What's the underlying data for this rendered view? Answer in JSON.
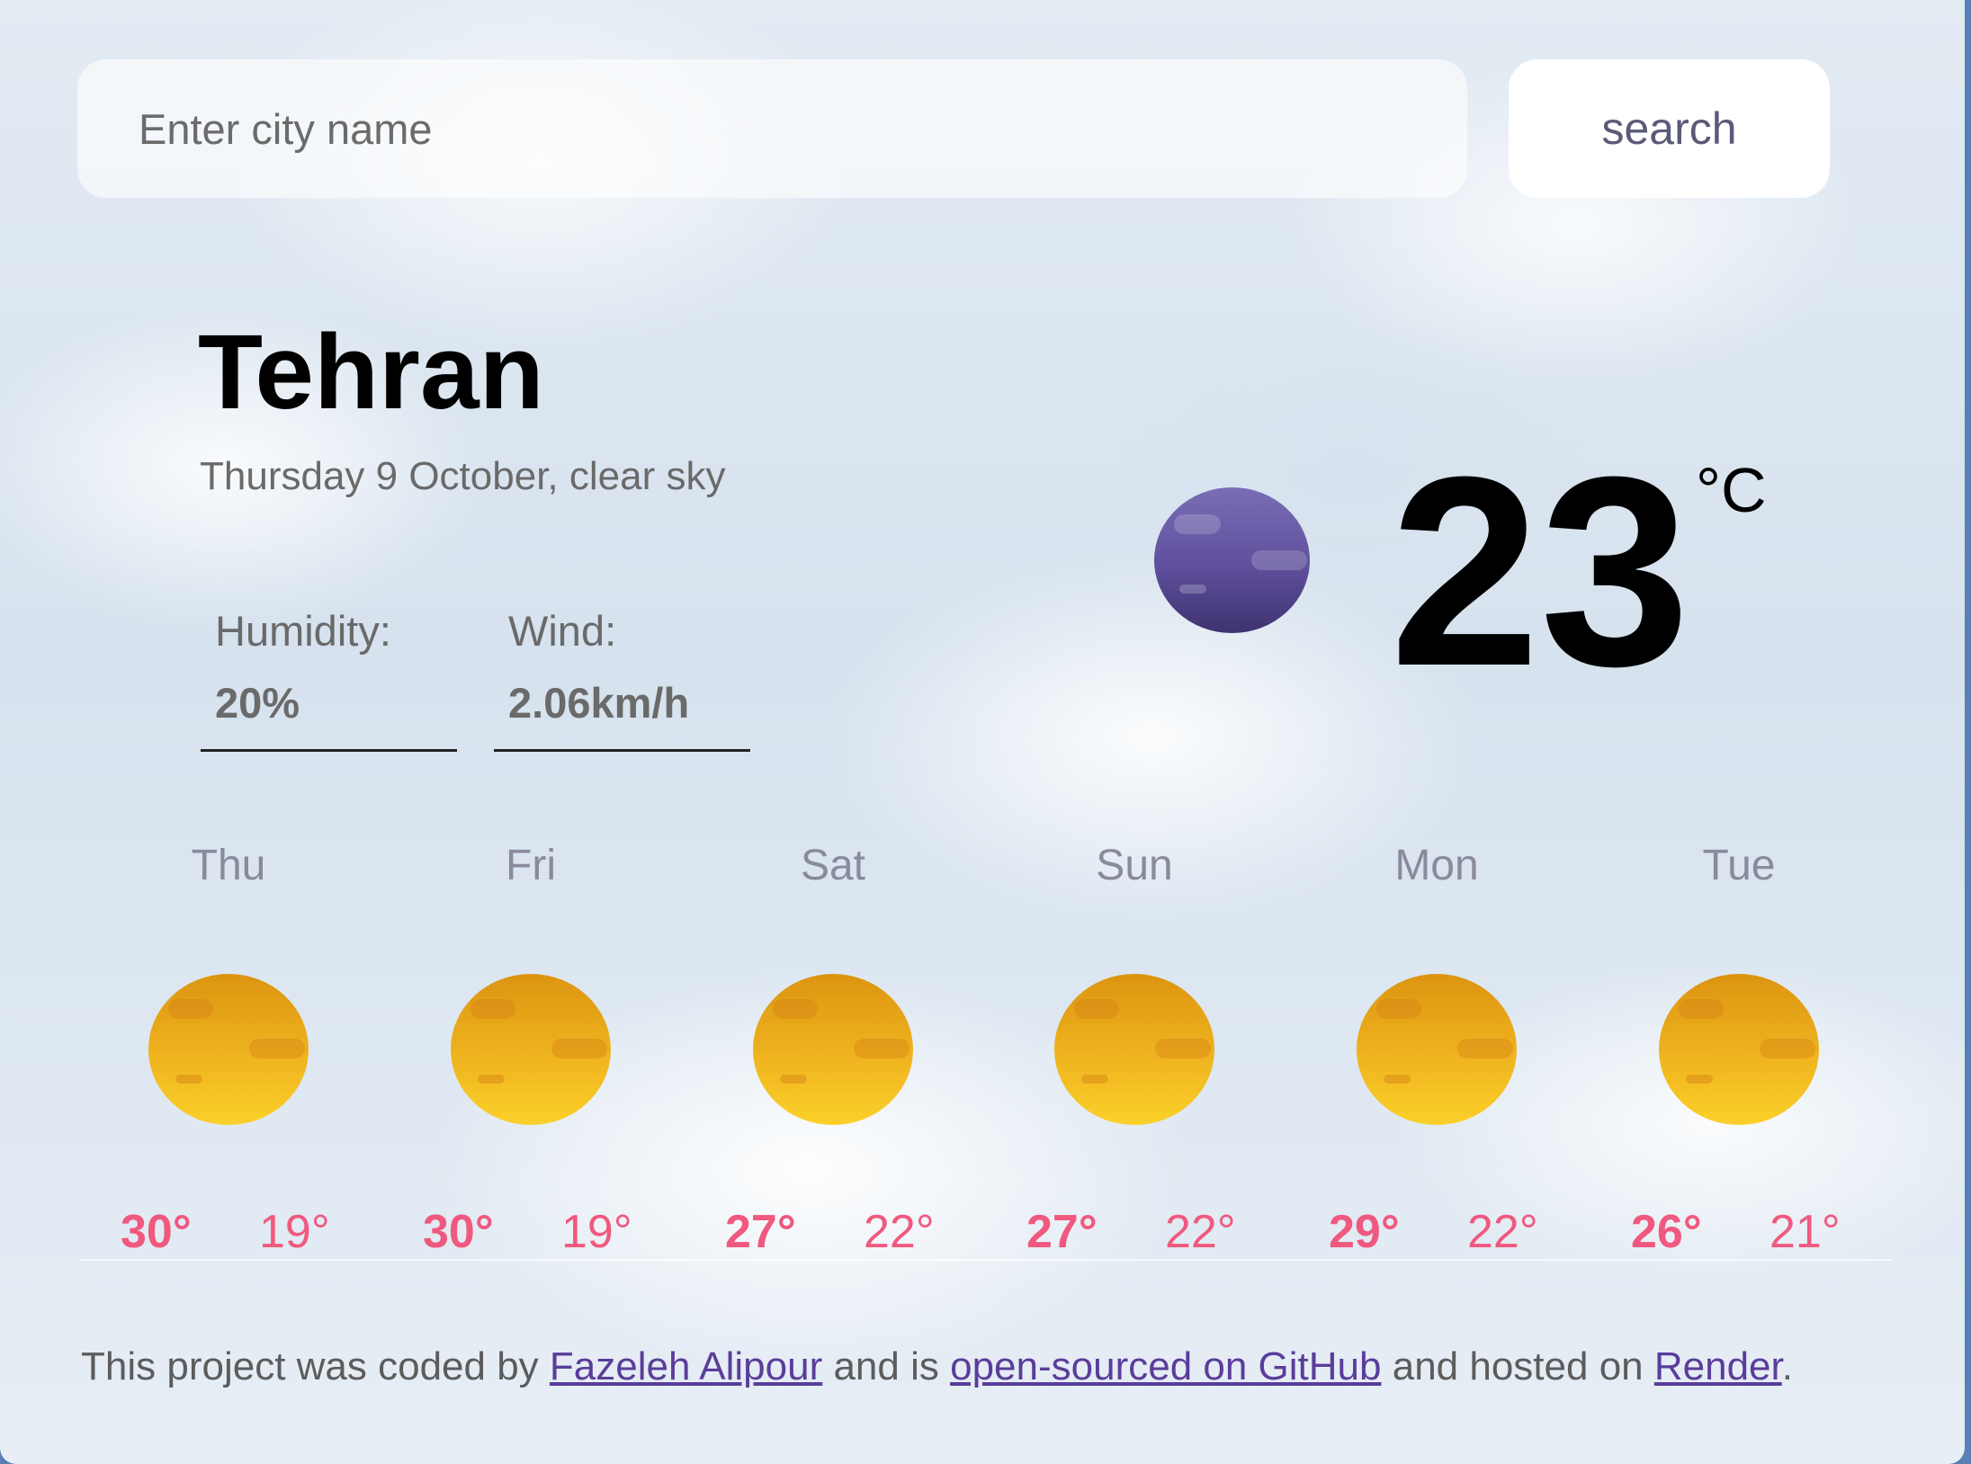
{
  "search": {
    "placeholder": "Enter city name",
    "value": "",
    "button_label": "search"
  },
  "current": {
    "city": "Tehran",
    "subtitle": "Thursday 9 October, clear sky",
    "humidity_label": "Humidity:",
    "humidity_value": "20%",
    "wind_label": "Wind:",
    "wind_value": "2.06km/h",
    "temperature": "23",
    "unit": "°C",
    "icon": "moon-icon"
  },
  "forecast": [
    {
      "day": "Thu",
      "max": "30°",
      "min": "19°",
      "icon": "sun-icon"
    },
    {
      "day": "Fri",
      "max": "30°",
      "min": "19°",
      "icon": "sun-icon"
    },
    {
      "day": "Sat",
      "max": "27°",
      "min": "22°",
      "icon": "sun-icon"
    },
    {
      "day": "Sun",
      "max": "27°",
      "min": "22°",
      "icon": "sun-icon"
    },
    {
      "day": "Mon",
      "max": "29°",
      "min": "22°",
      "icon": "sun-icon"
    },
    {
      "day": "Tue",
      "max": "26°",
      "min": "21°",
      "icon": "sun-icon"
    }
  ],
  "footer": {
    "text1": "This project was coded by ",
    "author_link": "Fazeleh Alipour",
    "text2": " and is ",
    "github_link": "open-sourced on GitHub",
    "text3": " and hosted on ",
    "host_link": "Render",
    "text4": "."
  },
  "colors": {
    "accent": "#f0597f",
    "link": "#5a3d9b",
    "moon": "#5f4f9c",
    "sun": "#efb41f"
  }
}
